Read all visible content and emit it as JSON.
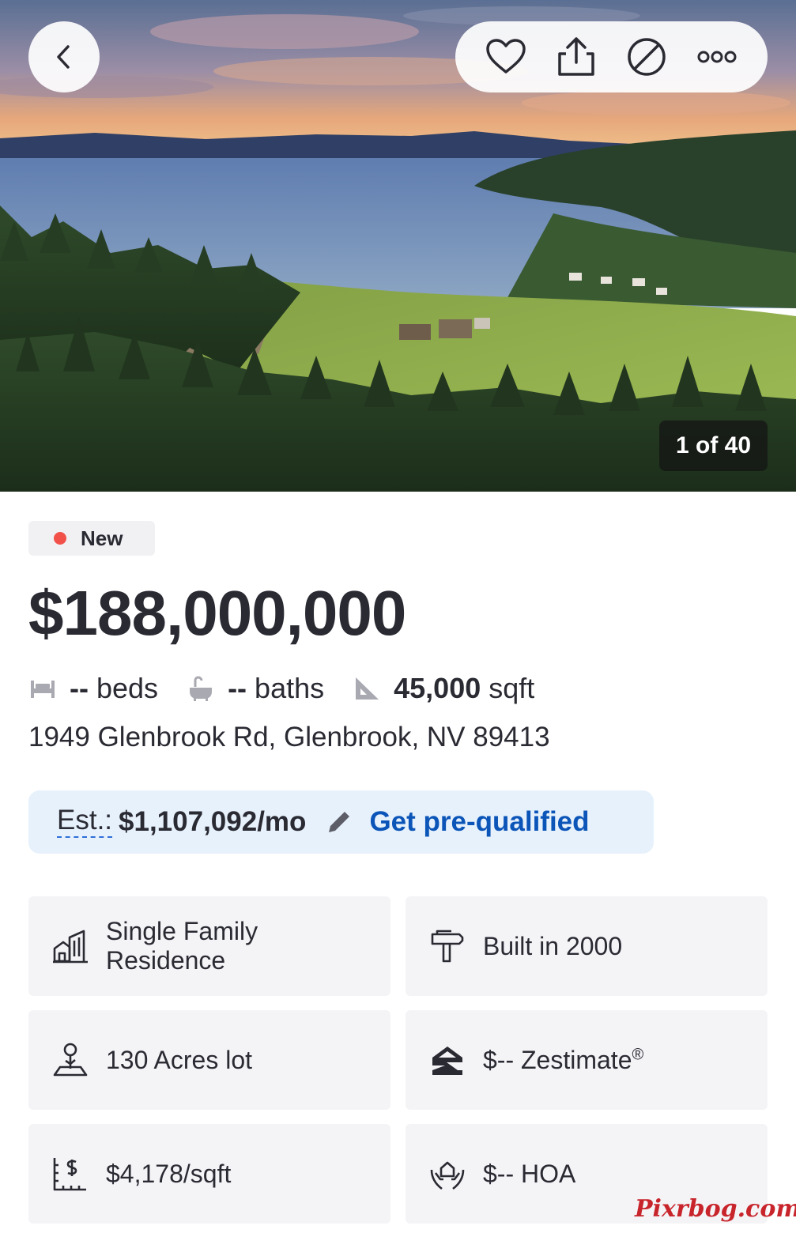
{
  "hero": {
    "photo_counter": "1 of 40",
    "back_icon": "chevron-left-icon",
    "actions": [
      "heart-icon",
      "share-icon",
      "hide-icon",
      "more-icon"
    ]
  },
  "listing": {
    "status_badge": "New",
    "status_color": "#f2514a",
    "price": "$188,000,000",
    "beds": {
      "value": "--",
      "label": "beds"
    },
    "baths": {
      "value": "--",
      "label": "baths"
    },
    "area": {
      "value": "45,000",
      "label": "sqft"
    },
    "address": "1949 Glenbrook Rd, Glenbrook, NV 89413"
  },
  "estimate": {
    "label": "Est.:",
    "value": "$1,107,092/mo",
    "link": "Get pre-qualified",
    "link_color": "#0c55b8"
  },
  "facts": [
    {
      "icon": "building-icon",
      "text": "Single Family Residence"
    },
    {
      "icon": "hammer-icon",
      "text": "Built in 2000"
    },
    {
      "icon": "lot-icon",
      "text": "130 Acres lot"
    },
    {
      "icon": "zillow-icon",
      "text": "$-- Zestimate",
      "sup": "®"
    },
    {
      "icon": "price-per-sqft-icon",
      "text": "$4,178/sqft"
    },
    {
      "icon": "hoa-icon",
      "text": "$-- HOA"
    }
  ],
  "watermark": "Pixrbog.com"
}
